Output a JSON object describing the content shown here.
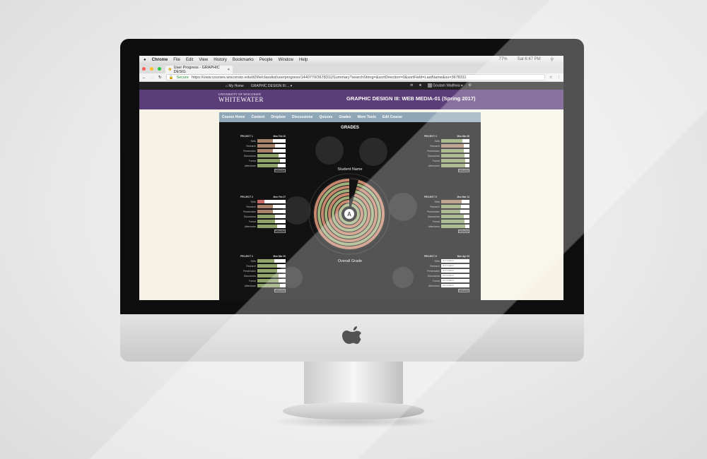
{
  "menubar": {
    "items": [
      "Chrome",
      "File",
      "Edit",
      "View",
      "History",
      "Bookmarks",
      "People",
      "Window",
      "Help"
    ],
    "battery": "77%",
    "clock": "Sat 6:47 PM"
  },
  "browser": {
    "tab_title": "User Progress - GRAPHIC DESIG",
    "secure_label": "Secure",
    "url": "https://uww.courses.wisconsin.edu/d2l/le/classlist/userprogress/1440770/3678311/Summary?searchString=&sortDirection=0&sortField=LastName&ou=3678311"
  },
  "d2l": {
    "home": "My Home",
    "course_crumb": "GRAPHIC DESIGN III:...",
    "user": "Goutam Wadhwa"
  },
  "banner": {
    "logo_small": "UNIVERSITY OF WISCONSIN",
    "logo_big": "WHITEWATER",
    "course_title": "GRAPHIC DESIGN III: WEB MEDIA-01 (Spring 2017)"
  },
  "coursenav": [
    "Course Home",
    "Content",
    "Dropbox",
    "Discussions",
    "Quizzes",
    "Grades",
    "More Tools",
    "Edit Course"
  ],
  "grades": {
    "heading": "GRADES",
    "student_name_label": "Student Name",
    "overall_label": "Overall Grade",
    "center_grade": "A",
    "feedback_label": "Feedback",
    "criteria": [
      "Skills",
      "Research",
      "Presentation",
      "Discussions",
      "Format",
      "Attendance"
    ],
    "projects": [
      {
        "title": "PROJECT 1",
        "date": "Mon Feb 20",
        "fills": [
          0.55,
          0.62,
          0.55,
          0.75,
          0.8,
          0.72
        ],
        "colors": [
          "#a8826a",
          "#a8826a",
          "#a8826a",
          "#8fa26a",
          "#8fa26a",
          "#8fa26a"
        ]
      },
      {
        "title": "PROJECT 2",
        "date": "Mon Feb 27",
        "fills": [
          0.25,
          0.55,
          0.55,
          0.62,
          0.62,
          0.7
        ],
        "colors": [
          "#c96a6a",
          "#a8826a",
          "#a8826a",
          "#8fa26a",
          "#8fa26a",
          "#8fa26a"
        ]
      },
      {
        "title": "PROJECT 3",
        "date": "Mon Mar 20",
        "fills": [
          0.6,
          0.7,
          0.7,
          0.75,
          0.75,
          0.8
        ],
        "colors": [
          "#8fa26a",
          "#8fa26a",
          "#8fa26a",
          "#8fa26a",
          "#8fa26a",
          "#8fa26a"
        ]
      },
      {
        "title": "PROJECT 4",
        "date": "Mon Mar 06",
        "fills": [
          0.75,
          0.8,
          0.8,
          0.82,
          0.85,
          0.85
        ],
        "colors": [
          "#8fa26a",
          "#a8826a",
          "#8fa26a",
          "#8fa26a",
          "#8fa26a",
          "#8fa26a"
        ]
      },
      {
        "title": "PROJECT 5",
        "date": "Mon Mar 13",
        "fills": [
          0.72,
          0.7,
          0.68,
          0.8,
          0.82,
          0.85
        ],
        "colors": [
          "#a8826a",
          "#8fa26a",
          "#8fa26a",
          "#8fa26a",
          "#8fa26a",
          "#8fa26a"
        ]
      },
      {
        "title": "PROJECT 6",
        "date": "Mon Apr 03",
        "fills": [
          0,
          0,
          0,
          0,
          0,
          0
        ],
        "colors": [
          "#fff",
          "#fff",
          "#fff",
          "#fff",
          "#fff",
          "#fff"
        ],
        "not_graded": "Not Graded"
      }
    ]
  }
}
